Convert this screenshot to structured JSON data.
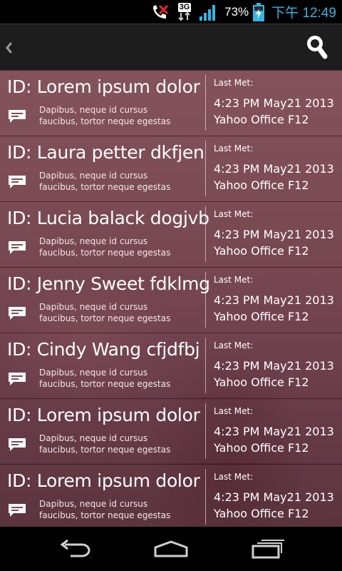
{
  "status_bar": {
    "network_type": "3G",
    "battery_percent": "73%",
    "time": "下午 12:49"
  },
  "action_bar": {
    "icons": [
      "back-icon",
      "search-icon"
    ]
  },
  "contacts": [
    {
      "title": "ID: Lorem ipsum dolor",
      "desc_line1": "Dapibus, neque id cursus",
      "desc_line2": "faucibus, tortor neque egestas",
      "last_met_label": "Last Met:",
      "last_met_date": "4:23 PM May21 2013",
      "last_met_place": "Yahoo Office F12"
    },
    {
      "title": "ID: Laura petter dkfjen",
      "desc_line1": "Dapibus, neque id cursus",
      "desc_line2": "faucibus, tortor neque egestas",
      "last_met_label": "Last Met:",
      "last_met_date": "4:23 PM May21 2013",
      "last_met_place": "Yahoo Office F12"
    },
    {
      "title": "ID: Lucia balack dogjvb",
      "desc_line1": "Dapibus, neque id cursus",
      "desc_line2": "faucibus, tortor neque egestas",
      "last_met_label": "Last Met:",
      "last_met_date": "4:23 PM May21 2013",
      "last_met_place": "Yahoo Office F12"
    },
    {
      "title": "ID: Jenny Sweet fdklmg",
      "desc_line1": "Dapibus, neque id cursus",
      "desc_line2": "faucibus, tortor neque egestas",
      "last_met_label": "Last Met:",
      "last_met_date": "4:23 PM May21 2013",
      "last_met_place": "Yahoo Office F12"
    },
    {
      "title": "ID: Cindy Wang cfjdfbj",
      "desc_line1": "Dapibus, neque id cursus",
      "desc_line2": "faucibus, tortor neque egestas",
      "last_met_label": "Last Met:",
      "last_met_date": "4:23 PM May21 2013",
      "last_met_place": "Yahoo Office F12"
    },
    {
      "title": "ID: Lorem ipsum dolor",
      "desc_line1": "Dapibus, neque id cursus",
      "desc_line2": "faucibus, tortor neque egestas",
      "last_met_label": "Last Met:",
      "last_met_date": "4:23 PM May21 2013",
      "last_met_place": "Yahoo Office F12"
    },
    {
      "title": "ID: Lorem ipsum dolor",
      "desc_line1": "Dapibus, neque id cursus",
      "desc_line2": "faucibus, tortor neque egestas",
      "last_met_label": "Last Met:",
      "last_met_date": "4:23 PM May21 2013",
      "last_met_place": "Yahoo Office F12"
    }
  ],
  "nav_bar": {
    "icons": [
      "nav-back-icon",
      "home-icon",
      "recent-apps-icon"
    ]
  },
  "colors": {
    "time_accent": "#33b5e5",
    "card_overlay": "#7d4f58"
  }
}
